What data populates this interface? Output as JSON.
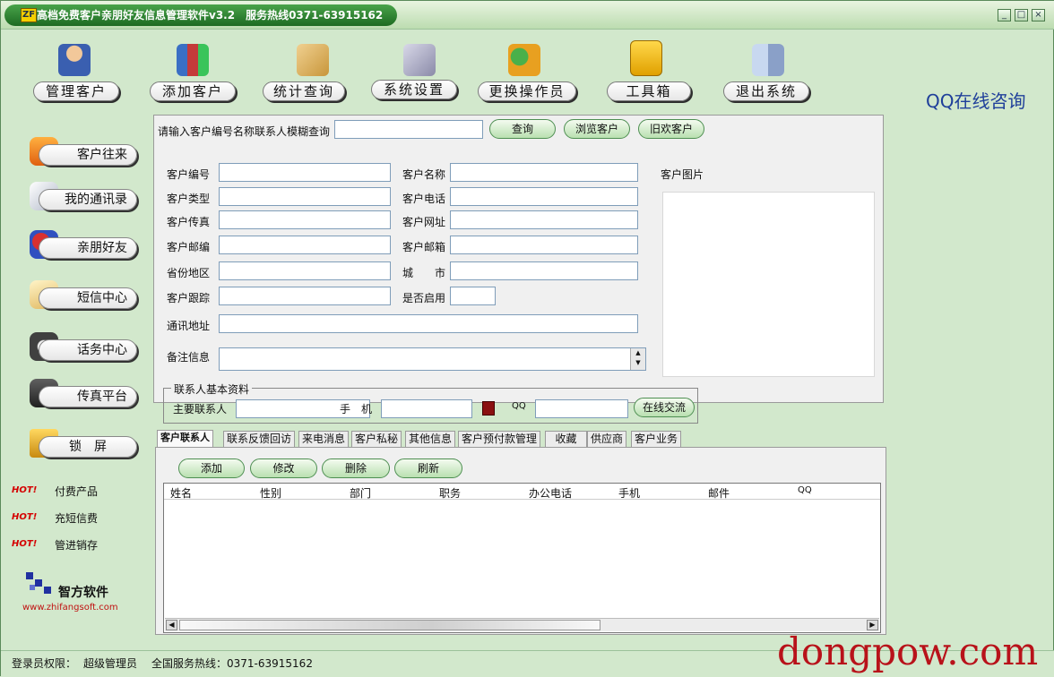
{
  "window": {
    "title": "高档免费客户亲朋好友信息管理软件v3.2　服务热线0371-63915162",
    "app_icon_text": "ZF",
    "minimize": "_",
    "restore": "□",
    "close": "×"
  },
  "top_nav": {
    "items": [
      {
        "label": "管理客户",
        "icon": "customer-person-icon"
      },
      {
        "label": "添加客户",
        "icon": "books-icon"
      },
      {
        "label": "统计查询",
        "icon": "chart-document-icon"
      },
      {
        "label": "系统设置",
        "icon": "settings-tools-icon"
      },
      {
        "label": "更换操作员",
        "icon": "users-icon"
      },
      {
        "label": "工具箱",
        "icon": "folder-toolbox-icon"
      },
      {
        "label": "退出系统",
        "icon": "exit-door-icon"
      }
    ],
    "qq_consult": "QQ在线咨询"
  },
  "sidebar": {
    "items": [
      {
        "label": "客户往来",
        "icon": "envelope-icon"
      },
      {
        "label": "我的通讯录",
        "icon": "address-book-icon"
      },
      {
        "label": "亲朋好友",
        "icon": "friends-icon"
      },
      {
        "label": "短信中心",
        "icon": "sms-envelope-icon"
      },
      {
        "label": "话务中心",
        "icon": "headset-icon"
      },
      {
        "label": "传真平台",
        "icon": "fax-icon"
      },
      {
        "label": "锁　屏",
        "icon": "lock-icon"
      }
    ],
    "hot_badge": "HOT!",
    "hot_links": [
      "付费产品",
      "充短信费",
      "管进销存"
    ],
    "logo_name": "智方软件",
    "logo_url": "www.zhifangsoft.com"
  },
  "search": {
    "label": "请输入客户编号名称联系人模糊查询",
    "value": "",
    "buttons": [
      "查询",
      "浏览客户",
      "旧欢客户"
    ]
  },
  "form": {
    "fields": {
      "code": {
        "label": "客户编号",
        "value": ""
      },
      "name": {
        "label": "客户名称",
        "value": ""
      },
      "type": {
        "label": "客户类型",
        "value": ""
      },
      "phone": {
        "label": "客户电话",
        "value": ""
      },
      "fax": {
        "label": "客户传真",
        "value": ""
      },
      "website": {
        "label": "客户网址",
        "value": ""
      },
      "postcode": {
        "label": "客户邮编",
        "value": ""
      },
      "email": {
        "label": "客户邮箱",
        "value": ""
      },
      "province": {
        "label": "省份地区",
        "value": ""
      },
      "city": {
        "label": "城　　市",
        "value": ""
      },
      "followup": {
        "label": "客户跟踪",
        "value": ""
      },
      "enabled": {
        "label": "是否启用",
        "value": ""
      },
      "address": {
        "label": "通讯地址",
        "value": ""
      },
      "notes": {
        "label": "备注信息",
        "value": ""
      }
    },
    "picture_label": "客户图片",
    "contact_group": {
      "legend": "联系人基本资料",
      "main_contact_label": "主要联系人",
      "main_contact_value": "",
      "mobile_label": "手　机",
      "mobile_value": "",
      "qq_label": "QQ",
      "qq_value": "",
      "online_chat_button": "在线交流"
    }
  },
  "tabs": [
    "客户联系人",
    "联系反馈回访",
    "来电消息",
    "客户私秘",
    "其他信息",
    "客户预付款管理",
    "收藏",
    "供应商",
    "客户业务"
  ],
  "tab_toolbar": [
    "添加",
    "修改",
    "删除",
    "刷新"
  ],
  "table": {
    "columns": [
      "姓名",
      "性别",
      "部门",
      "职务",
      "办公电话",
      "手机",
      "邮件",
      "QQ"
    ],
    "rows": []
  },
  "status_bar": {
    "login_label": "登录员权限：",
    "login_role": "超级管理员",
    "hotline": "全国服务热线：0371-63915162"
  },
  "watermark": "dongpow.com"
}
